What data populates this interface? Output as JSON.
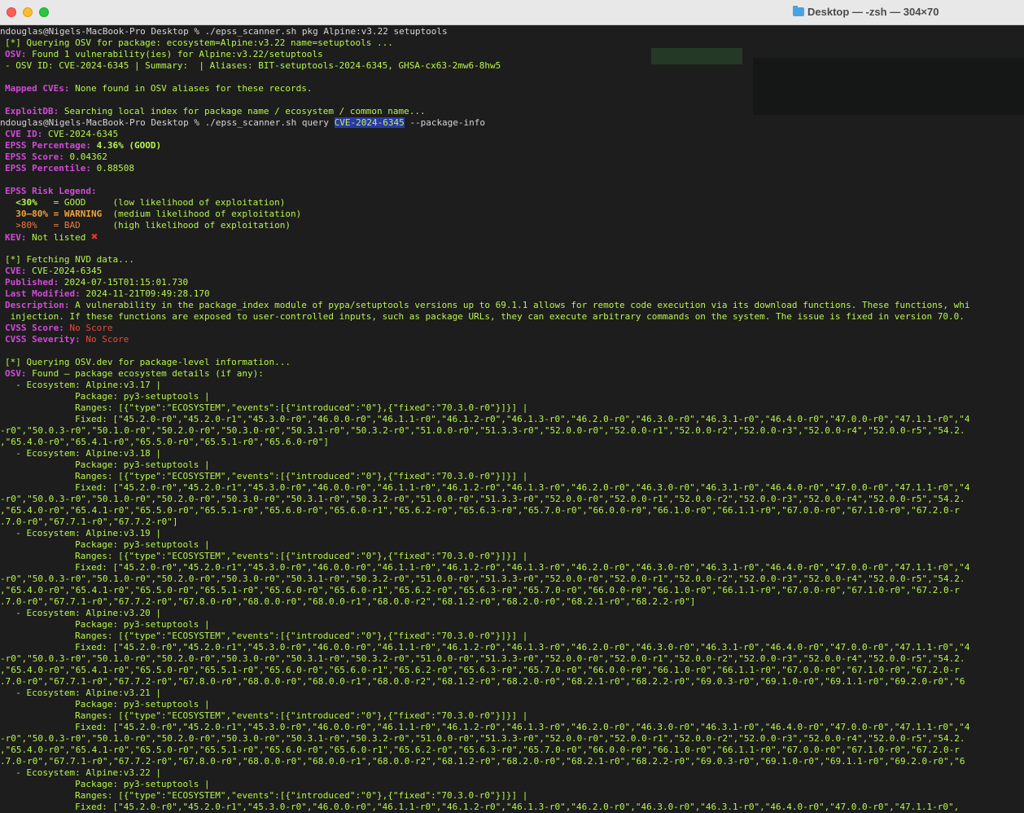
{
  "window": {
    "title": "Desktop — -zsh — 304×70"
  },
  "terminal": {
    "l1": "ndouglas@Nigels-MacBook-Pro Desktop % ./epss_scanner.sh pkg Alpine:v3.22 setuptools",
    "l2": "[*] Querying OSV for package: ecosystem=Alpine:v3.22 name=setuptools ...",
    "l3_label": "OSV:",
    "l3_text": " Found 1 vulnerability(ies) for Alpine:v3.22/setuptools",
    "l4": "- OSV ID: CVE-2024-6345 | Summary:  | Aliases: BIT-setuptools-2024-6345, GHSA-cx63-2mw6-8hw5",
    "l6_label": "Mapped CVEs:",
    "l6_text": " None found in OSV aliases for these records.",
    "l8_label": "ExploitDB:",
    "l8_text": " Searching local index for package name / ecosystem / common name...",
    "l9_pre": "ndouglas@Nigels-MacBook-Pro Desktop % ./epss_scanner.sh query ",
    "l9_hl": "CVE-2024-6345",
    "l9_post": " --package-info",
    "l10_label": "CVE ID:",
    "l10_text": " CVE-2024-6345",
    "l11_label": "EPSS Percentage:",
    "l11_text": " 4.36% (GOOD)",
    "l12_label": "EPSS Score:",
    "l12_text": " 0.04362",
    "l13_label": "EPSS Percentile:",
    "l13_text": " 0.88508",
    "l15": "EPSS Risk Legend:",
    "l16_a": "  <30%",
    "l16_b": "   = GOOD     (low likelihood of exploitation)",
    "l17_a": "  30–80%",
    "l17_b": " = WARNING",
    "l17_c": "  (medium likelihood of exploitation)",
    "l18_a": "  >80%",
    "l18_b": "   = BAD",
    "l18_c": "      (high likelihood of exploitation)",
    "l19_label": "KEV:",
    "l19_text": " Not listed ",
    "l19_icon": "✖",
    "l21": "[*] Fetching NVD data...",
    "l22_label": "CVE:",
    "l22_text": " CVE-2024-6345",
    "l23_label": "Published:",
    "l23_text": " 2024-07-15T01:15:01.730",
    "l24_label": "Last Modified:",
    "l24_text": " 2024-11-21T09:49:28.170",
    "l25_label": "Description:",
    "l25_text": " A vulnerability in the package_index module of pypa/setuptools versions up to 69.1.1 allows for remote code execution via its download functions. These functions, whi",
    "l26": " injection. If these functions are exposed to user-controlled inputs, such as package URLs, they can execute arbitrary commands on the system. The issue is fixed in version 70.0.",
    "l27_label": "CVSS Score:",
    "l27_text": " No Score",
    "l28_label": "CVSS Severity:",
    "l28_text": " No Score",
    "l30": "[*] Querying OSV.dev for package-level information...",
    "l31_label": "OSV:",
    "l31_text": " Found – package ecosystem details (if any):",
    "e17": "  - Ecosystem: Alpine:v3.17 |",
    "e18": "  - Ecosystem: Alpine:v3.18 |",
    "e19": "  - Ecosystem: Alpine:v3.19 |",
    "e20": "  - Ecosystem: Alpine:v3.20 |",
    "e21": "  - Ecosystem: Alpine:v3.21 |",
    "e22": "  - Ecosystem: Alpine:v3.22 |",
    "pkg": "             Package: py3-setuptools |",
    "ranges": "             Ranges: [{\"type\":\"ECOSYSTEM\",\"events\":[{\"introduced\":\"0\"},{\"fixed\":\"70.3.0-r0\"}]}] |",
    "fixed1": "             Fixed: [\"45.2.0-r0\",\"45.2.0-r1\",\"45.3.0-r0\",\"46.0.0-r0\",\"46.1.1-r0\",\"46.1.2-r0\",\"46.1.3-r0\",\"46.2.0-r0\",\"46.3.0-r0\",\"46.3.1-r0\",\"46.4.0-r0\",\"47.0.0-r0\",\"47.1.1-r0\",\"4",
    "fixed2": "-r0\",\"50.0.3-r0\",\"50.1.0-r0\",\"50.2.0-r0\",\"50.3.0-r0\",\"50.3.1-r0\",\"50.3.2-r0\",\"51.0.0-r0\",\"51.3.3-r0\",\"52.0.0-r0\",\"52.0.0-r1\",\"52.0.0-r2\",\"52.0.0-r3\",\"52.0.0-r4\",\"52.0.0-r5\",\"54.2.",
    "f17_3": ",\"65.4.0-r0\",\"65.4.1-r0\",\"65.5.0-r0\",\"65.5.1-r0\",\"65.6.0-r0\"]",
    "f18_3": ",\"65.4.0-r0\",\"65.4.1-r0\",\"65.5.0-r0\",\"65.5.1-r0\",\"65.6.0-r0\",\"65.6.0-r1\",\"65.6.2-r0\",\"65.6.3-r0\",\"65.7.0-r0\",\"66.0.0-r0\",\"66.1.0-r0\",\"66.1.1-r0\",\"67.0.0-r0\",\"67.1.0-r0\",\"67.2.0-r",
    "f18_4": ".7.0-r0\",\"67.7.1-r0\",\"67.7.2-r0\"]",
    "f19_4": ".7.0-r0\",\"67.7.1-r0\",\"67.7.2-r0\",\"67.8.0-r0\",\"68.0.0-r0\",\"68.0.0-r1\",\"68.0.0-r2\",\"68.1.2-r0\",\"68.2.0-r0\",\"68.2.1-r0\",\"68.2.2-r0\"]",
    "f20_4": ".7.0-r0\",\"67.7.1-r0\",\"67.7.2-r0\",\"67.8.0-r0\",\"68.0.0-r0\",\"68.0.0-r1\",\"68.0.0-r2\",\"68.1.2-r0\",\"68.2.0-r0\",\"68.2.1-r0\",\"68.2.2-r0\",\"69.0.3-r0\",\"69.1.0-r0\",\"69.1.1-r0\",\"69.2.0-r0\",\"6",
    "f22_1": "             Fixed: [\"45.2.0-r0\",\"45.2.0-r1\",\"45.3.0-r0\",\"46.0.0-r0\",\"46.1.1-r0\",\"46.1.2-r0\",\"46.1.3-r0\",\"46.2.0-r0\",\"46.3.0-r0\",\"46.3.1-r0\",\"46.4.0-r0\",\"47.0.0-r0\",\"47.1.1-r0\","
  }
}
